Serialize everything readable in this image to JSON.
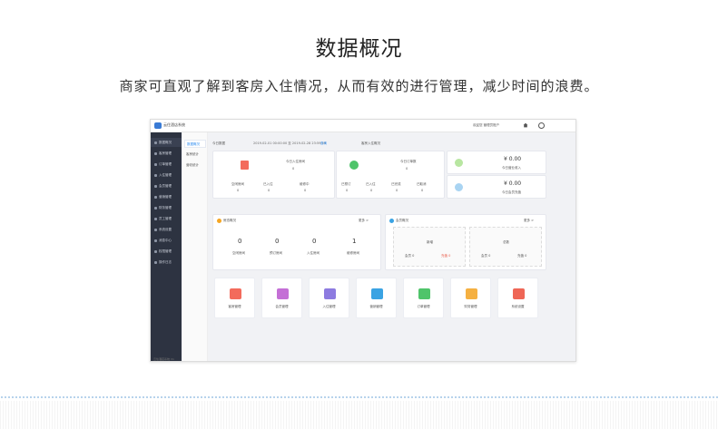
{
  "heading": {
    "title": "数据概况",
    "subtitle": "商家可直观了解到客房入住情况，从而有效的进行管理，减少时间的浪费。"
  },
  "app": {
    "brand": "云住酒店系统",
    "top_right": "欢迎您 管理员账户",
    "footer": "云住酒店系统 V1"
  },
  "sidebar": {
    "items": [
      "数据概况",
      "客房管理",
      "订单管理",
      "入住管理",
      "会员管理",
      "营销管理",
      "财务管理",
      "员工管理",
      "系统设置",
      "消息中心",
      "权限管理",
      "操作日志"
    ]
  },
  "subnav": {
    "items": [
      "数据概况",
      "客房统计",
      "营收统计"
    ]
  },
  "filter": {
    "label": "今日数据",
    "range": "2019-02-01 00:00:00 至 2019-02-28 23:59:59",
    "button": "查询",
    "center_label": "客房入住概况"
  },
  "overview": {
    "card1": {
      "label": "今日入住房间",
      "value": "0",
      "sub": [
        {
          "label": "空闲房间",
          "value": "0"
        },
        {
          "label": "已入住",
          "value": "0"
        },
        {
          "label": "维修中",
          "value": "0"
        }
      ]
    },
    "card2": {
      "label": "今日订单数",
      "value": "0",
      "sub": [
        {
          "label": "已预订",
          "value": "0"
        },
        {
          "label": "已入住",
          "value": "0"
        },
        {
          "label": "已完成",
          "value": "0"
        },
        {
          "label": "已取消",
          "value": "0"
        }
      ]
    },
    "money": [
      {
        "value": "¥ 0.00",
        "label": "今日营业收入"
      },
      {
        "value": "¥ 0.00",
        "label": "今日会员充值"
      }
    ]
  },
  "room_stats": {
    "title": "房态概况",
    "right": "更多 >",
    "items": [
      {
        "value": "0",
        "label": "空闲房间"
      },
      {
        "value": "0",
        "label": "预订房间"
      },
      {
        "value": "0",
        "label": "入住房间"
      },
      {
        "value": "1",
        "label": "维修房间"
      }
    ]
  },
  "member_stats": {
    "title": "会员概况",
    "right": "更多 >",
    "boxes": [
      {
        "title": "新增",
        "left": "会员 0",
        "right": "充值 0"
      },
      {
        "title": "总数",
        "left": "会员 0",
        "right": "充值 0"
      }
    ]
  },
  "modules": [
    {
      "label": "客房管理",
      "color": "#f36b5c"
    },
    {
      "label": "会员管理",
      "color": "#c46fd6"
    },
    {
      "label": "入住管理",
      "color": "#8d7be0"
    },
    {
      "label": "营销管理",
      "color": "#3aa3e3"
    },
    {
      "label": "订单管理",
      "color": "#4fc46a"
    },
    {
      "label": "财务管理",
      "color": "#f5b041"
    },
    {
      "label": "系统设置",
      "color": "#ef6656"
    }
  ]
}
